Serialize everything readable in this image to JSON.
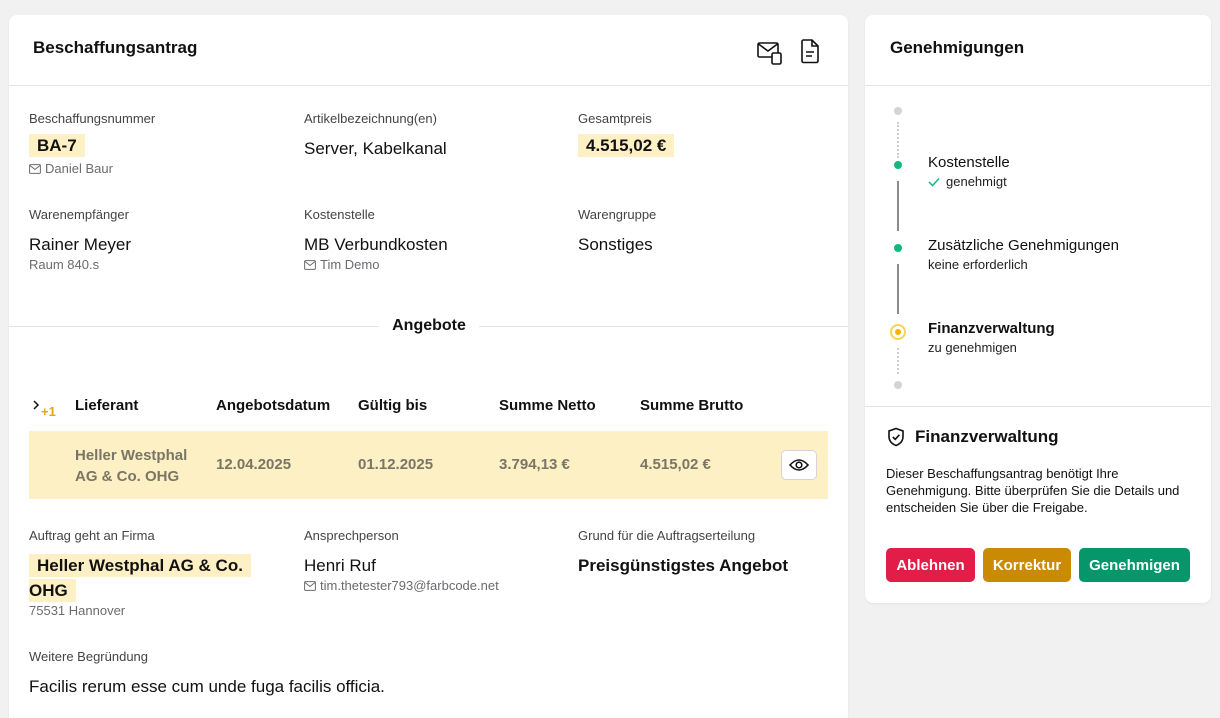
{
  "main": {
    "title": "Beschaffungsantrag",
    "fields": {
      "number_label": "Beschaffungsnummer",
      "number_value": "BA-7",
      "number_user": "Daniel Baur",
      "article_label": "Artikelbezeichnung(en)",
      "article_value": "Server, Kabelkanal",
      "total_label": "Gesamtpreis",
      "total_value": "4.515,02 €",
      "recipient_label": "Warenempfänger",
      "recipient_value": "Rainer Meyer",
      "recipient_room": "Raum 840.s",
      "costcenter_label": "Kostenstelle",
      "costcenter_value": "MB Verbundkosten",
      "costcenter_user": "Tim Demo",
      "group_label": "Warengruppe",
      "group_value": "Sonstiges"
    },
    "offers": {
      "section_title": "Angebote",
      "more_count": "+1",
      "headers": [
        "Lieferant",
        "Angebotsdatum",
        "Gültig bis",
        "Summe Netto",
        "Summe Brutto"
      ],
      "row": {
        "supplier_line1": "Heller Westphal",
        "supplier_line2": "AG & Co. OHG",
        "date": "12.04.2025",
        "valid_until": "01.12.2025",
        "net": "3.794,13 €",
        "gross": "4.515,02 €"
      }
    },
    "order": {
      "company_label": "Auftrag geht an Firma",
      "company_line1": "Heller Westphal AG & Co.",
      "company_line2": "OHG",
      "company_city": "75531 Hannover",
      "contact_label": "Ansprechperson",
      "contact_value": "Henri Ruf",
      "contact_email": "tim.thetester793@farbcode.net",
      "reason_label": "Grund für die Auftragserteilung",
      "reason_value": "Preisgünstigstes Angebot",
      "more_reason_label": "Weitere Begründung",
      "more_reason_value": "Facilis rerum esse cum unde fuga facilis officia."
    }
  },
  "side": {
    "title": "Genehmigungen",
    "steps": [
      {
        "title": "Kostenstelle",
        "status": "genehmigt"
      },
      {
        "title": "Zusätzliche Genehmigungen",
        "status": "keine erforderlich"
      },
      {
        "title": "Finanzverwaltung",
        "status": "zu genehmigen"
      }
    ],
    "panel_title": "Finanzverwaltung",
    "panel_text": "Dieser Beschaffungsantrag benötigt Ihre Genehmigung. Bitte überprüfen Sie die Details und entscheiden Sie über die Freigabe.",
    "buttons": {
      "reject": "Ablehnen",
      "correct": "Korrektur",
      "approve": "Genehmigen"
    }
  },
  "colors": {
    "highlight": "#fdf0c4",
    "green": "#10b981",
    "amber": "#f5b301",
    "reject": "#e11d48",
    "correct": "#ca8a04",
    "approve": "#059669"
  }
}
